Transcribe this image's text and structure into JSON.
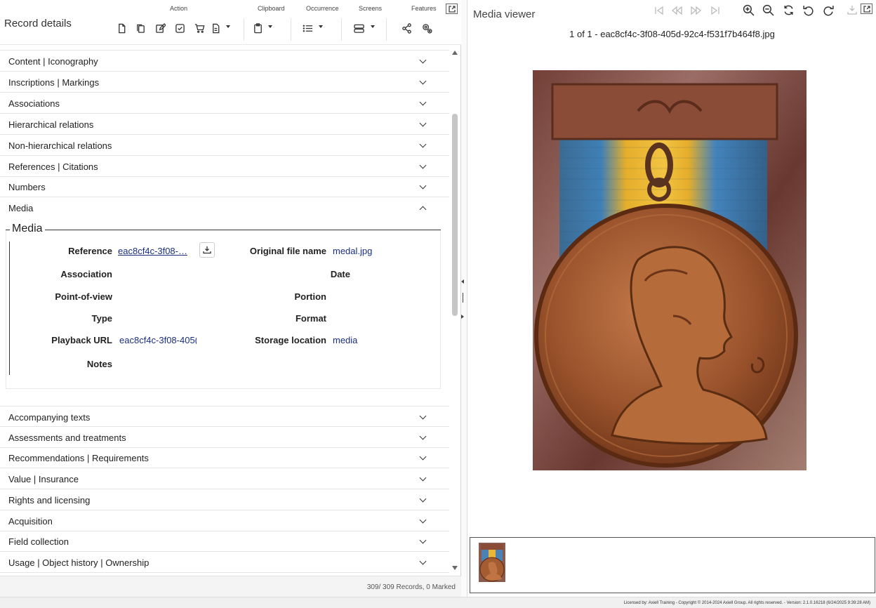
{
  "left_panel": {
    "title": "Record details",
    "toolbar_groups": {
      "action": "Action",
      "clipboard": "Clipboard",
      "occurrence": "Occurrence",
      "screens": "Screens",
      "features": "Features"
    },
    "sections_top": [
      "Content | Iconography",
      "Inscriptions | Markings",
      "Associations",
      "Hierarchical relations",
      "Non-hierarchical relations",
      "References | Citations",
      "Numbers",
      "Media"
    ],
    "media": {
      "legend": "Media",
      "fields": {
        "reference_label": "Reference",
        "reference_value": "eac8cf4c-3f08-…",
        "original_file_name_label": "Original file name",
        "original_file_name_value": "medal.jpg",
        "association_label": "Association",
        "date_label": "Date",
        "point_of_view_label": "Point-of-view",
        "portion_label": "Portion",
        "type_label": "Type",
        "format_label": "Format",
        "playback_url_label": "Playback URL",
        "playback_url_value": "eac8cf4c-3f08-405(",
        "storage_location_label": "Storage location",
        "storage_location_value": "media",
        "notes_label": "Notes"
      }
    },
    "sections_bottom": [
      "Accompanying texts",
      "Assessments and treatments",
      "Recommendations | Requirements",
      "Value | Insurance",
      "Rights and licensing",
      "Acquisition",
      "Field collection",
      "Usage | Object history | Ownership"
    ],
    "record_count": "309/ 309 Records, 0 Marked"
  },
  "media_viewer": {
    "title": "Media viewer",
    "file_caption": "1 of 1 - eac8cf4c-3f08-405d-92c4-f531f7b464f8.jpg"
  },
  "footer": {
    "license_text": "Licensed by: Axiell Training - Copyright © 2014-2024 Axiell Group. All rights reserved. - Version: 2.1.0.16218 (6/24/2025 9:39:28 AM)"
  },
  "colors": {
    "link": "#1a2f80",
    "divider": "#e4e4e4",
    "scroll_thumb": "#c6c6c6"
  }
}
